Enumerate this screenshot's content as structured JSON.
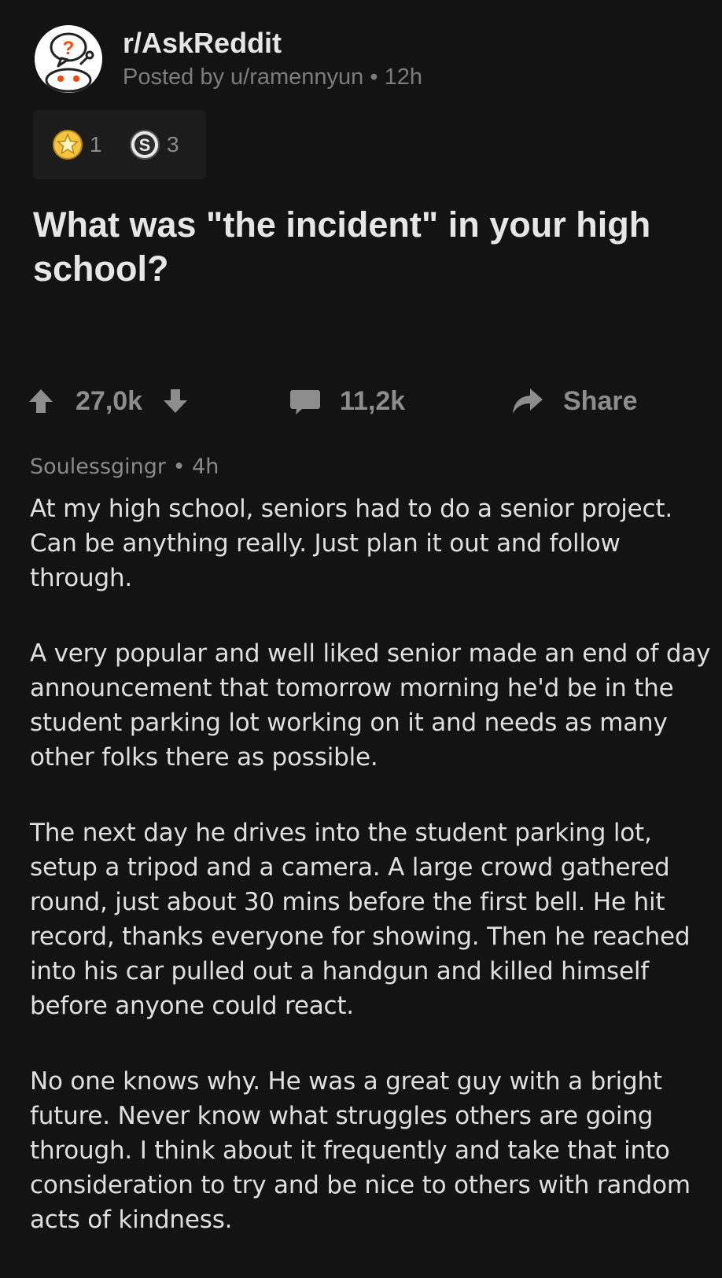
{
  "post": {
    "subreddit": "r/AskReddit",
    "posted_by": "Posted by u/ramennyun • 12h",
    "awards": [
      {
        "icon": "star-award-icon",
        "count": "1"
      },
      {
        "icon": "silver-coin-icon",
        "count": "3"
      }
    ],
    "title": "What was \"the incident\" in your high school?",
    "actions": {
      "upvotes": "27,0k",
      "comments": "11,2k",
      "share": "Share"
    }
  },
  "comment": {
    "author_meta": "Soulessgingr • 4h",
    "paragraphs": [
      "At my high school, seniors had to do a senior project. Can be anything really. Just plan it out and follow through.",
      "A very popular and well liked senior made an end of day announcement that tomorrow morning he'd be in the student parking lot working on it and needs as many other folks there as possible.",
      "The next day he drives into the student parking lot, setup a tripod and a camera. A large crowd gathered round, just about 30 mins before the first bell. He hit record, thanks everyone for showing. Then he reached into his car pulled out a handgun and killed himself before anyone could react.",
      "No one knows why. He was a great guy with a bright future. Never know what struggles others are going through. I think about it frequently and take that into consideration to try and be nice to others with random acts of kindness."
    ]
  },
  "colors": {
    "background": "#131313",
    "text_primary": "#e6e6e6",
    "text_muted": "#7c7c7c",
    "awards_bg": "#1c1c1c",
    "star_award": "#f0b429"
  }
}
